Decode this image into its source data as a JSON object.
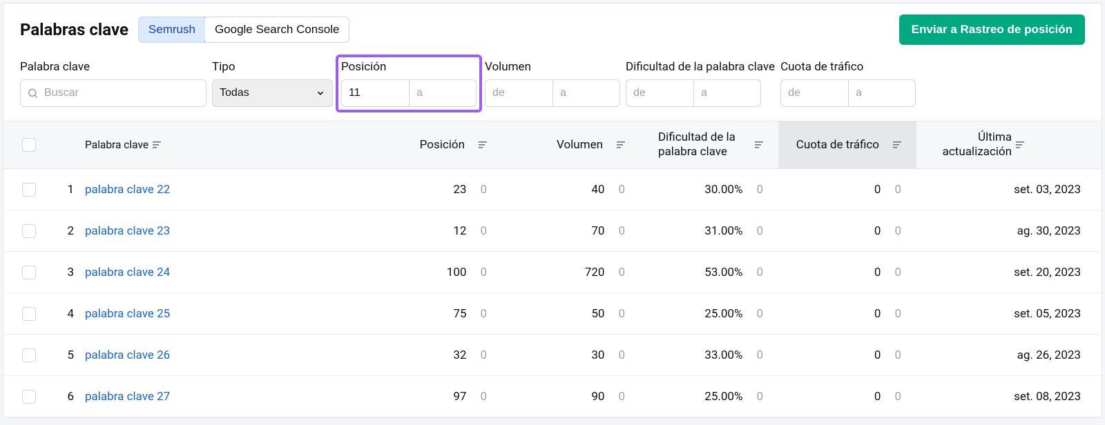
{
  "header": {
    "title": "Palabras clave",
    "tabs": [
      {
        "label": "Semrush",
        "active": true
      },
      {
        "label": "Google Search Console",
        "active": false
      }
    ],
    "primary_button": "Enviar a Rastreo de posición"
  },
  "filters": {
    "keyword": {
      "label": "Palabra clave",
      "placeholder": "Buscar",
      "value": ""
    },
    "type": {
      "label": "Tipo",
      "selected": "Todas"
    },
    "position": {
      "label": "Posición",
      "from": "11",
      "to_placeholder": "a",
      "to": "",
      "highlight": true
    },
    "volume": {
      "label": "Volumen",
      "from_placeholder": "de",
      "from": "",
      "to_placeholder": "a",
      "to": ""
    },
    "difficulty": {
      "label": "Dificultad de la palabra clave",
      "from_placeholder": "de",
      "from": "",
      "to_placeholder": "a",
      "to": ""
    },
    "traffic": {
      "label": "Cuota de tráfico",
      "from_placeholder": "de",
      "from": "",
      "to_placeholder": "a",
      "to": ""
    }
  },
  "table": {
    "columns": {
      "keyword": "Palabra clave",
      "position": "Posición",
      "volume": "Volumen",
      "difficulty": "Dificultad de la palabra clave",
      "traffic": "Cuota de tráfico",
      "updated": "Última actualización"
    },
    "rows": [
      {
        "index": "1",
        "keyword": "palabra clave 22",
        "position": "23",
        "pos_delta": "0",
        "volume": "40",
        "vol_delta": "0",
        "difficulty": "30.00%",
        "diff_delta": "0",
        "traffic": "0",
        "traf_delta": "0",
        "updated": "set. 03, 2023"
      },
      {
        "index": "2",
        "keyword": "palabra clave 23",
        "position": "12",
        "pos_delta": "0",
        "volume": "70",
        "vol_delta": "0",
        "difficulty": "31.00%",
        "diff_delta": "0",
        "traffic": "0",
        "traf_delta": "0",
        "updated": "ag. 30, 2023"
      },
      {
        "index": "3",
        "keyword": "palabra clave 24",
        "position": "100",
        "pos_delta": "0",
        "volume": "720",
        "vol_delta": "0",
        "difficulty": "53.00%",
        "diff_delta": "0",
        "traffic": "0",
        "traf_delta": "0",
        "updated": "set. 20, 2023"
      },
      {
        "index": "4",
        "keyword": "palabra clave 25",
        "position": "75",
        "pos_delta": "0",
        "volume": "50",
        "vol_delta": "0",
        "difficulty": "25.00%",
        "diff_delta": "0",
        "traffic": "0",
        "traf_delta": "0",
        "updated": "set. 05, 2023"
      },
      {
        "index": "5",
        "keyword": "palabra clave 26",
        "position": "32",
        "pos_delta": "0",
        "volume": "30",
        "vol_delta": "0",
        "difficulty": "33.00%",
        "diff_delta": "0",
        "traffic": "0",
        "traf_delta": "0",
        "updated": "ag. 26, 2023"
      },
      {
        "index": "6",
        "keyword": "palabra clave 27",
        "position": "97",
        "pos_delta": "0",
        "volume": "90",
        "vol_delta": "0",
        "difficulty": "25.00%",
        "diff_delta": "0",
        "traffic": "0",
        "traf_delta": "0",
        "updated": "set. 08, 2023"
      }
    ]
  }
}
